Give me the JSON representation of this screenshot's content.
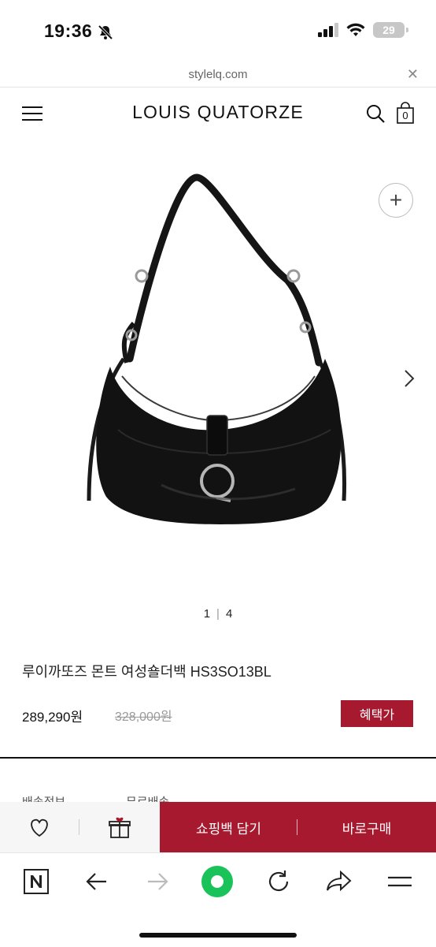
{
  "status_bar": {
    "time": "19:36",
    "battery": "29"
  },
  "browser": {
    "url": "stylelq.com",
    "close_icon": "✕"
  },
  "header": {
    "logo": "LOUIS QUATORZE",
    "cart_count": "0"
  },
  "gallery": {
    "current_page": "1",
    "total_pages": "4",
    "zoom_icon": "+"
  },
  "product": {
    "name": "루이까또즈 몬트 여성숄더백 HS3SO13BL",
    "sale_price": "289,290원",
    "original_price": "328,000원",
    "benefit_label": "혜택가"
  },
  "shipping": {
    "label": "배송정보",
    "value": "무료배송"
  },
  "actions": {
    "add_to_cart": "쇼핑백 담기",
    "buy_now": "바로구매"
  },
  "colors": {
    "brand_red": "#a6192e",
    "toolbar_green": "#19c35a"
  }
}
